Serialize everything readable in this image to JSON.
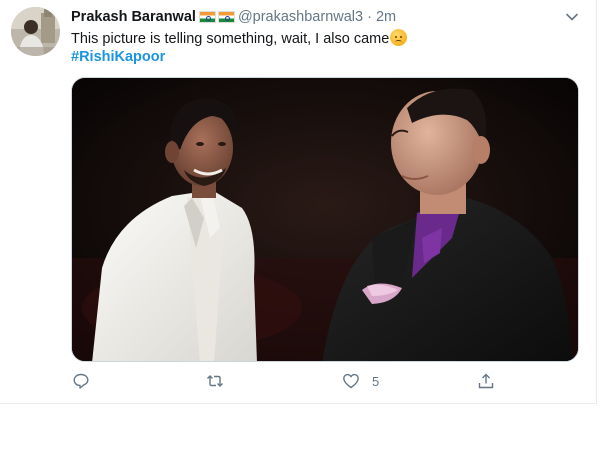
{
  "tweet": {
    "author": {
      "name": "Prakash Baranwal",
      "handle": "@prakashbarnwal3",
      "avatar_icon": "profile-photo"
    },
    "separator": "·",
    "timestamp": "2m",
    "text": "This picture is telling something, wait, I also came",
    "emoji_icon": "disappointed-face",
    "hashtag": "#RishiKapoor",
    "media": {
      "description_icon": "photo"
    },
    "actions": {
      "reply_icon": "reply-icon",
      "retweet_icon": "retweet-icon",
      "like_icon": "heart-icon",
      "like_count": "5",
      "share_icon": "share-icon"
    },
    "colors": {
      "link": "#1b95e0",
      "muted": "#657786",
      "text": "#14171a"
    }
  }
}
